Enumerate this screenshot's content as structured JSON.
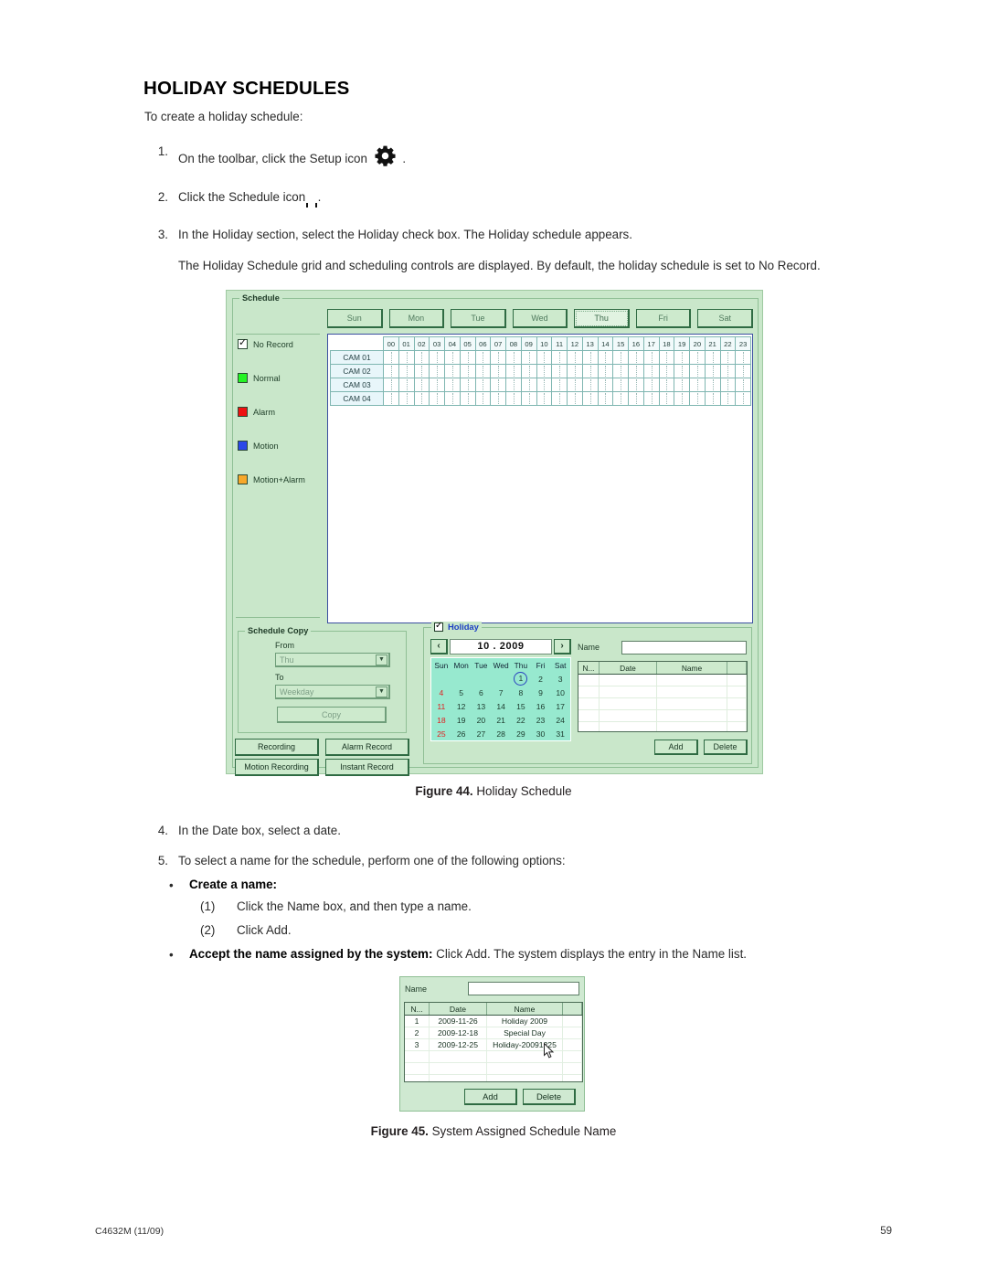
{
  "document": {
    "title": "HOLIDAY SCHEDULES",
    "intro": "To create a holiday schedule:",
    "steps": [
      {
        "num": "1.",
        "text_before": "On the toolbar, click the Setup icon",
        "icon": "gear-icon",
        "text_after": "."
      },
      {
        "num": "2.",
        "text_before": "Click the Schedule icon",
        "icon": "schedule-calendar-icon",
        "text_after": "."
      },
      {
        "num": "3.",
        "text_before": "In the Holiday section, select the Holiday check box. The Holiday schedule appears.",
        "icon": "",
        "text_after": ""
      }
    ],
    "paragraph": "The Holiday Schedule grid and scheduling controls are displayed. By default, the holiday schedule is set to No Record.",
    "step4": {
      "num": "4.",
      "text": "In the Date box, select a date."
    },
    "step5": {
      "num": "5.",
      "text": "To select a name for the schedule, perform one of the following options:"
    },
    "bullet1_bold": "Create a name:",
    "substeps": [
      {
        "num": "(1)",
        "text": "Click the Name box, and then type a name."
      },
      {
        "num": "(2)",
        "text": "Click Add."
      }
    ],
    "bullet2_bold": "Accept the name assigned by the system:",
    "bullet2_rest": " Click Add. The system displays the entry in the Name list.",
    "figure44_caption_bold": "Figure 44.",
    "figure44_caption_text": " Holiday Schedule",
    "figure45_caption_bold": "Figure 45.",
    "figure45_caption_text": " System Assigned Schedule Name",
    "footer_left": "C4632M (11/09)",
    "footer_right": "59"
  },
  "schedule_dialog": {
    "group_label": "Schedule",
    "day_tabs": [
      {
        "label": "Sun",
        "active": false
      },
      {
        "label": "Mon",
        "active": false
      },
      {
        "label": "Tue",
        "active": false
      },
      {
        "label": "Wed",
        "active": false
      },
      {
        "label": "Thu",
        "active": true
      },
      {
        "label": "Fri",
        "active": false
      },
      {
        "label": "Sat",
        "active": false
      }
    ],
    "legend": [
      {
        "label": "No Record",
        "type": "checkbox",
        "checked": true,
        "color": ""
      },
      {
        "label": "Normal",
        "type": "swatch",
        "color": "#24f424"
      },
      {
        "label": "Alarm",
        "type": "swatch",
        "color": "#ee1111"
      },
      {
        "label": "Motion",
        "type": "swatch",
        "color": "#2b47e8"
      },
      {
        "label": "Motion+Alarm",
        "type": "swatch",
        "color": "#f7a82a"
      }
    ],
    "grid": {
      "hours": [
        "00",
        "01",
        "02",
        "03",
        "04",
        "05",
        "06",
        "07",
        "08",
        "09",
        "10",
        "11",
        "12",
        "13",
        "14",
        "15",
        "16",
        "17",
        "18",
        "19",
        "20",
        "21",
        "22",
        "23"
      ],
      "cameras": [
        "CAM 01",
        "CAM 02",
        "CAM 03",
        "CAM 04"
      ]
    },
    "schedule_copy": {
      "group_label": "Schedule Copy",
      "from_label": "From",
      "from_value": "Thu",
      "to_label": "To",
      "to_value": "Weekday",
      "copy_button": "Copy"
    },
    "action_buttons": [
      "Recording",
      "Alarm Record",
      "Motion Recording",
      "Instant Record"
    ],
    "holiday": {
      "title": "Holiday",
      "checked": true,
      "calendar": {
        "prev_icon": "chevron-left-icon",
        "next_icon": "chevron-right-icon",
        "month_year": "10 . 2009",
        "dow": [
          "Sun",
          "Mon",
          "Tue",
          "Wed",
          "Thu",
          "Fri",
          "Sat"
        ],
        "weeks": [
          [
            "",
            "",
            "",
            "",
            "1",
            "2",
            "3"
          ],
          [
            "4",
            "5",
            "6",
            "7",
            "8",
            "9",
            "10"
          ],
          [
            "11",
            "12",
            "13",
            "14",
            "15",
            "16",
            "17"
          ],
          [
            "18",
            "19",
            "20",
            "21",
            "22",
            "23",
            "24"
          ],
          [
            "25",
            "26",
            "27",
            "28",
            "29",
            "30",
            "31"
          ]
        ],
        "selected_day": "1"
      },
      "name_label": "Name",
      "name_value": "",
      "list_headers": [
        "N...",
        "Date",
        "Name",
        ""
      ],
      "list_rows": [],
      "add_button": "Add",
      "delete_button": "Delete"
    }
  },
  "mini_dialog": {
    "name_label": "Name",
    "name_value": "",
    "list_headers": [
      "N...",
      "Date",
      "Name",
      ""
    ],
    "list_rows": [
      {
        "n": "1",
        "date": "2009-11-26",
        "name": "Holiday 2009"
      },
      {
        "n": "2",
        "date": "2009-12-18",
        "name": "Special Day"
      },
      {
        "n": "3",
        "date": "2009-12-25",
        "name": "Holiday-20091225"
      }
    ],
    "add_button": "Add",
    "delete_button": "Delete"
  }
}
